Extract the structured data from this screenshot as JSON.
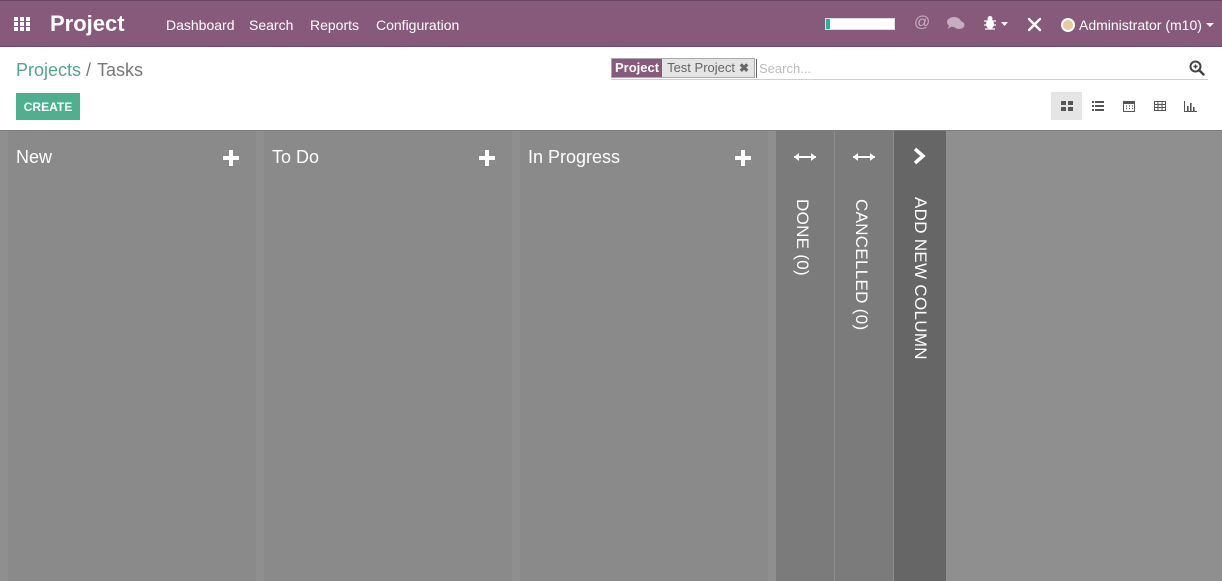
{
  "navbar": {
    "brand": "Project",
    "menu": [
      "Dashboard",
      "Search",
      "Reports",
      "Configuration"
    ],
    "progress_percent": 6,
    "at_icon": "@",
    "user": "Administrator (m10)",
    "colors": {
      "bar": "#875a7b",
      "progress": "#21b799"
    },
    "icons": [
      "apps-grid-icon",
      "at-icon",
      "chat-icon",
      "bug-icon",
      "tools-icon",
      "avatar"
    ]
  },
  "breadcrumb": {
    "parent": "Projects",
    "separator": "/",
    "current": "Tasks"
  },
  "buttons": {
    "create": "CREATE"
  },
  "search": {
    "facet_category": "Project",
    "facet_value": "Test Project",
    "placeholder": "Search..."
  },
  "views": [
    "kanban-icon",
    "list-icon",
    "calendar-icon",
    "pivot-icon",
    "graph-icon"
  ],
  "kanban": {
    "columns": [
      {
        "title": "New"
      },
      {
        "title": "To Do"
      },
      {
        "title": "In Progress"
      }
    ],
    "folded": [
      {
        "title": "DONE (0)"
      },
      {
        "title": "CANCELLED (0)"
      }
    ],
    "add_column": "ADD NEW COLUMN"
  }
}
